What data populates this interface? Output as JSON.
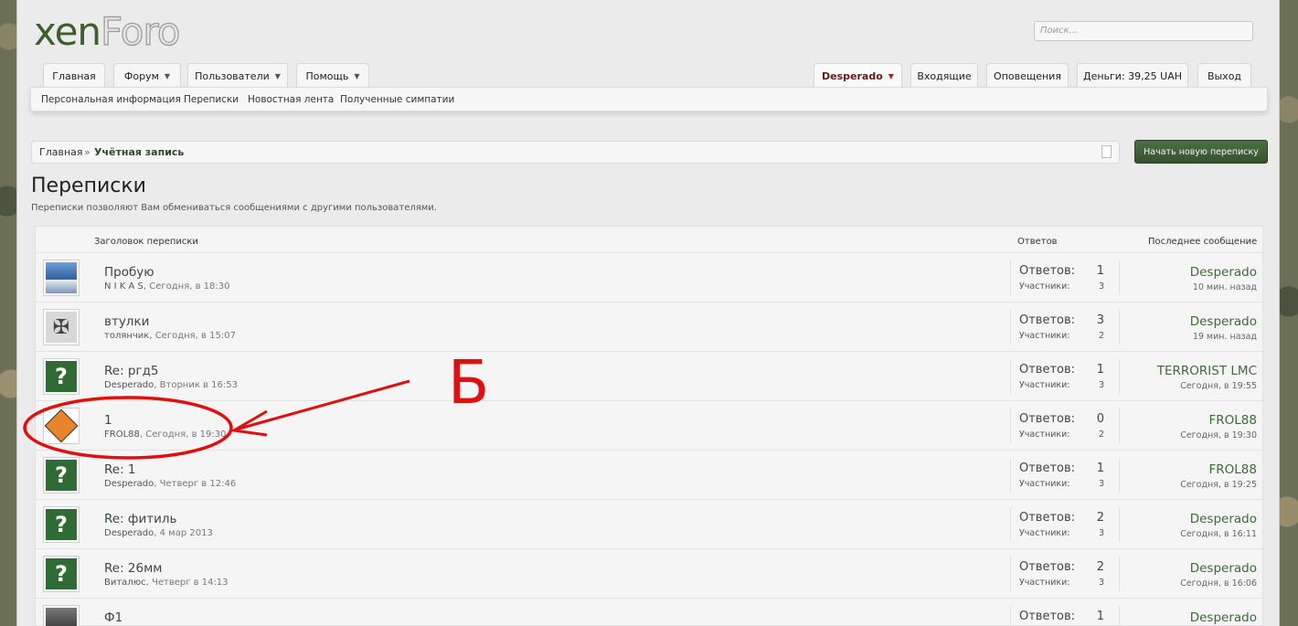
{
  "logo": {
    "part1": "xen",
    "part2": "Foro"
  },
  "search": {
    "placeholder": "Поиск..."
  },
  "nav": {
    "left": [
      "Главная",
      "Форум",
      "Пользователи",
      "Помощь"
    ],
    "user": "Desperado",
    "right": [
      "Входящие",
      "Оповещения",
      "Деньги: 39,25 UAH",
      "Выход"
    ]
  },
  "subnav": [
    "Персональная информация",
    "Переписки",
    "Новостная лента",
    "Полученные симпатии"
  ],
  "breadcrumb": {
    "home": "Главная",
    "sep": "»",
    "current": "Учётная запись"
  },
  "new_button": "Начать новую переписку",
  "page": {
    "title": "Переписки",
    "description": "Переписки позволяют Вам обмениваться сообщениями с другими пользователями."
  },
  "columns": {
    "title": "Заголовок переписки",
    "replies": "Ответов",
    "last": "Последнее сообщение"
  },
  "labels": {
    "replies": "Ответов:",
    "participants": "Участники:"
  },
  "rows": [
    {
      "title": "Пробую",
      "author": "N I K A S",
      "date": "Сегодня, в 18:30",
      "replies": "1",
      "participants": "3",
      "last_user": "Desperado",
      "last_time": "10 мин. назад",
      "avatar": "ship-avatar-icon"
    },
    {
      "title": "втулки",
      "author": "толянчик",
      "date": "Сегодня, в 15:07",
      "replies": "3",
      "participants": "2",
      "last_user": "Desperado",
      "last_time": "19 мин. назад",
      "avatar": "eagle-avatar-icon"
    },
    {
      "title": "Re: ргд5",
      "author": "Desperado",
      "date": "Вторник в 16:53",
      "replies": "1",
      "participants": "3",
      "last_user": "TERRORIST LMC",
      "last_time": "Сегодня, в 19:55",
      "avatar": "question-avatar-icon"
    },
    {
      "title": "1",
      "author": "FROL88",
      "date": "Сегодня, в 19:30",
      "replies": "0",
      "participants": "2",
      "last_user": "FROL88",
      "last_time": "Сегодня, в 19:30",
      "avatar": "explosives-avatar-icon"
    },
    {
      "title": "Re: 1",
      "author": "Desperado",
      "date": "Четверг в 12:46",
      "replies": "1",
      "participants": "3",
      "last_user": "FROL88",
      "last_time": "Сегодня, в 19:25",
      "avatar": "question-avatar-icon"
    },
    {
      "title": "Re: фитиль",
      "author": "Desperado",
      "date": "4 мар 2013",
      "replies": "2",
      "participants": "3",
      "last_user": "Desperado",
      "last_time": "Сегодня, в 16:11",
      "avatar": "question-avatar-icon"
    },
    {
      "title": "Re: 26мм",
      "author": "Виталюс",
      "date": "Четверг в 14:13",
      "replies": "2",
      "participants": "3",
      "last_user": "Desperado",
      "last_time": "Сегодня, в 16:06",
      "avatar": "question-avatar-icon"
    },
    {
      "title": "Ф1",
      "author": "",
      "date": "",
      "replies": "1",
      "participants": "",
      "last_user": "Desperado",
      "last_time": "",
      "avatar": "dark-avatar-icon"
    }
  ],
  "annotation": {
    "label": "Б",
    "color": "#e01010"
  }
}
